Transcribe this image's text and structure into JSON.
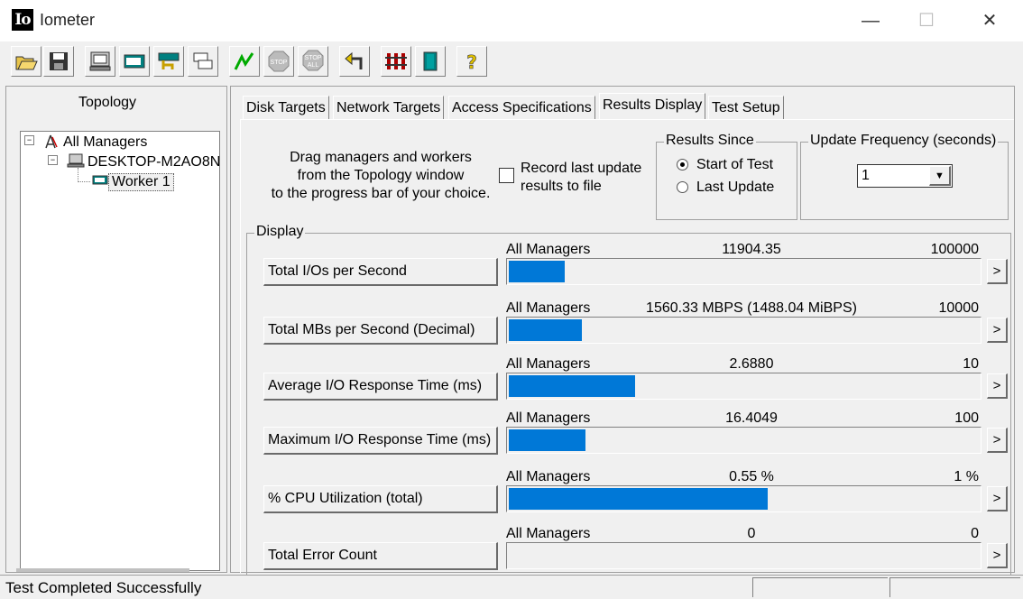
{
  "window": {
    "logo": "Io",
    "title": "Iometer",
    "minimize": "—",
    "maximize": "☐",
    "close": "✕"
  },
  "toolbar": {
    "buttons": [
      "open-icon",
      "save-icon",
      "new-manager-icon",
      "disk-worker-icon",
      "network-worker-icon",
      "copy-worker-icon",
      "start-icon",
      "stop-icon",
      "stop-all-icon",
      "reset-icon",
      "exit-icon",
      "workers-icon",
      "help-icon"
    ]
  },
  "topology": {
    "title": "Topology",
    "tree": [
      {
        "label": "All Managers",
        "expander": "⊟"
      },
      {
        "label": "DESKTOP-M2AO8N",
        "expander": "⊟"
      },
      {
        "label": "Worker 1"
      }
    ]
  },
  "tabs": [
    "Disk Targets",
    "Network Targets",
    "Access Specifications",
    "Results Display",
    "Test Setup"
  ],
  "active_tab": "Results Display",
  "results_display": {
    "instructions": [
      "Drag managers and workers",
      "from the Topology window",
      "to the progress bar of your choice."
    ],
    "record_checkbox": {
      "label_line1": "Record last update",
      "label_line2": "results to file",
      "checked": false
    },
    "results_since": {
      "title": "Results Since",
      "options": [
        "Start of Test",
        "Last Update"
      ],
      "selected": "Start of Test"
    },
    "update_frequency": {
      "title": "Update Frequency (seconds)",
      "value": "1",
      "dropdown_icon": "▼"
    },
    "display_title": "Display",
    "metrics": [
      {
        "label": "Total I/Os per Second",
        "source": "All Managers",
        "value": "11904.35",
        "max": "100000",
        "fill": 0.119,
        "arrow": ">"
      },
      {
        "label": "Total MBs per Second (Decimal)",
        "source": "All Managers",
        "value": "1560.33 MBPS (1488.04 MiBPS)",
        "max": "10000",
        "fill": 0.156,
        "arrow": ">"
      },
      {
        "label": "Average I/O Response Time (ms)",
        "source": "All Managers",
        "value": "2.6880",
        "max": "10",
        "fill": 0.2688,
        "arrow": ">"
      },
      {
        "label": "Maximum I/O Response Time (ms)",
        "source": "All Managers",
        "value": "16.4049",
        "max": "100",
        "fill": 0.164,
        "arrow": ">"
      },
      {
        "label": "% CPU Utilization (total)",
        "source": "All Managers",
        "value": "0.55 %",
        "max": "1 %",
        "fill": 0.55,
        "arrow": ">"
      },
      {
        "label": "Total Error Count",
        "source": "All Managers",
        "value": "0",
        "max": "0",
        "fill": 0,
        "arrow": ">"
      }
    ]
  },
  "status": {
    "message": "Test Completed Successfully"
  },
  "colors": {
    "bar": "#0078d7",
    "background": "#f0f0f0"
  }
}
